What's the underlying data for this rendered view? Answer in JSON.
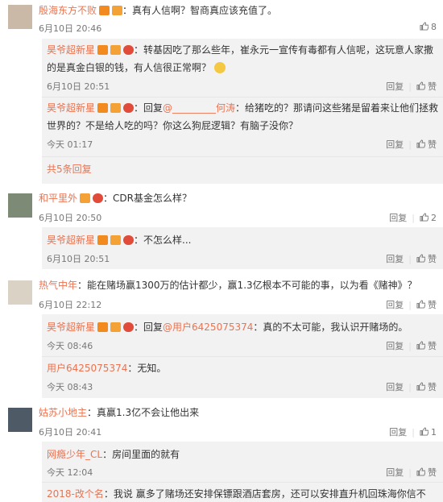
{
  "comments": [
    {
      "name": "殷海东方不败",
      "text": "：真有人信啊？智商真应该充值了。",
      "time": "6月10日 20:46",
      "likes": "8"
    },
    {
      "name": "昊爷超新星",
      "text": "：转基因吃了那么些年，崔永元一宣传有毒都有人信呢，这玩意人家撒",
      "text2": "的是真金白银的钱，有人信很正常啊？",
      "time": "6月10日 20:51",
      "reply": "回复",
      "like": "赞"
    },
    {
      "name": "昊爷超新星",
      "reply_prefix": "：回复",
      "mention": "@_________何涛",
      "text": "：给猪吃的？那请问这些猪是留着来让他们拯救",
      "text2": "世界的？不是给人吃的吗？你这么狗屁逻辑？有脑子没你？",
      "time": "今天 01:17",
      "reply": "回复",
      "like": "赞"
    },
    {
      "more": "共5条回复"
    },
    {
      "name": "和平里外",
      "text": "：CDR基金怎么样？",
      "time": "6月10日 20:50",
      "reply": "回复",
      "likes": "2"
    },
    {
      "name": "昊爷超新星",
      "text": "：不怎么样...",
      "time": "6月10日 20:51",
      "reply": "回复",
      "like": "赞"
    },
    {
      "name": "热气中年",
      "text": "：能在赌场赢1300万的估计都少，赢1.3亿根本不可能的事，以为看《赌神》？",
      "time": "6月10日 22:12",
      "reply": "回复",
      "like": "赞"
    },
    {
      "name": "昊爷超新星",
      "reply_prefix": "：回复",
      "mention": "@用户6425075374",
      "text": "：真的不太可能，我认识开赌场的。",
      "time": "今天 08:46",
      "reply": "回复",
      "like": "赞"
    },
    {
      "name": "用户6425075374",
      "text": "：无知。",
      "time": "今天 08:43",
      "reply": "回复",
      "like": "赞"
    },
    {
      "name": "姑苏小地主",
      "text": "：真赢1.3亿不会让他出来",
      "time": "6月10日 20:41",
      "reply": "回复",
      "likes": "1"
    },
    {
      "name": "网瘾少年_CL",
      "text": "：房间里面的就有",
      "time": "今天 12:04",
      "reply": "回复",
      "like": "赞"
    },
    {
      "name": "2018-改个名",
      "text": "：我说 赢多了赌场还安排保镖跟酒店套房，还可以安排直升机回珠海你信不"
    }
  ]
}
